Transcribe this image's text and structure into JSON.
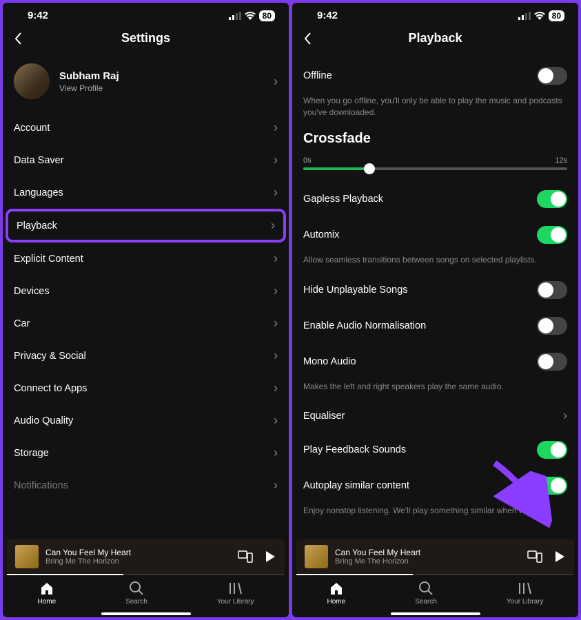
{
  "status": {
    "time": "9:42",
    "battery": "80"
  },
  "left": {
    "title": "Settings",
    "profile": {
      "name": "Subham Raj",
      "subtitle": "View Profile"
    },
    "items": [
      {
        "label": "Account"
      },
      {
        "label": "Data Saver"
      },
      {
        "label": "Languages"
      },
      {
        "label": "Playback",
        "highlight": true
      },
      {
        "label": "Explicit Content"
      },
      {
        "label": "Devices"
      },
      {
        "label": "Car"
      },
      {
        "label": "Privacy & Social"
      },
      {
        "label": "Connect to Apps"
      },
      {
        "label": "Audio Quality"
      },
      {
        "label": "Storage"
      },
      {
        "label": "Notifications",
        "faded": true
      }
    ]
  },
  "right": {
    "title": "Playback",
    "offline": {
      "label": "Offline",
      "desc": "When you go offline, you'll only be able to play the music and podcasts you've downloaded."
    },
    "crossfade": {
      "title": "Crossfade",
      "min": "0s",
      "max": "12s"
    },
    "toggles": {
      "gapless": {
        "label": "Gapless Playback",
        "on": true
      },
      "automix": {
        "label": "Automix",
        "on": true,
        "desc": "Allow seamless transitions between songs on selected playlists."
      },
      "hide": {
        "label": "Hide Unplayable Songs",
        "on": false
      },
      "norm": {
        "label": "Enable Audio Normalisation",
        "on": false
      },
      "mono": {
        "label": "Mono Audio",
        "on": false,
        "desc": "Makes the left and right speakers play the same audio."
      },
      "equaliser": {
        "label": "Equaliser"
      },
      "feedback": {
        "label": "Play Feedback Sounds",
        "on": true
      },
      "autoplay": {
        "label": "Autoplay similar content",
        "on": true,
        "desc": "Enjoy nonstop listening. We'll play something similar when what"
      }
    }
  },
  "nowPlaying": {
    "title": "Can You Feel My Heart",
    "artist": "Bring Me The Horizon"
  },
  "nav": {
    "home": "Home",
    "search": "Search",
    "library": "Your Library"
  }
}
